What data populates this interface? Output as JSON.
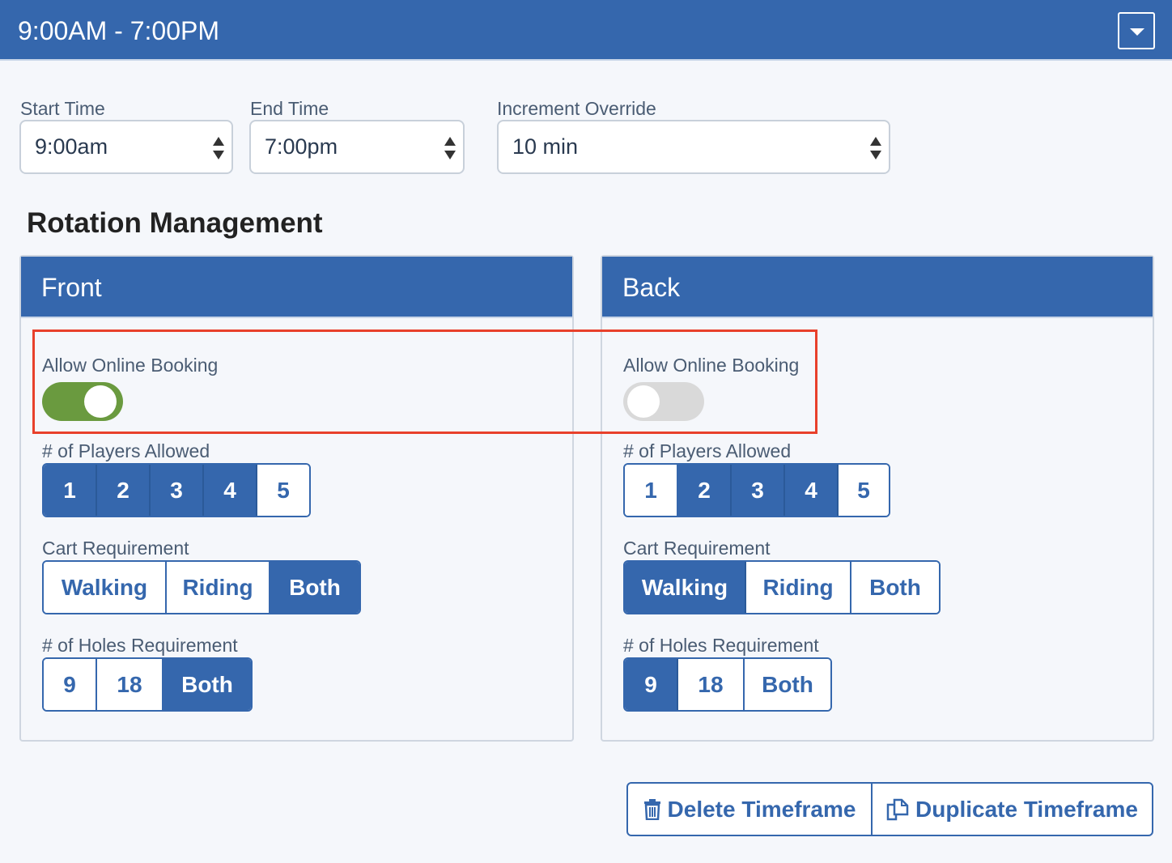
{
  "header": {
    "title": "9:00AM - 7:00PM",
    "menu_icon": "caret-down-icon"
  },
  "times": {
    "start_label": "Start Time",
    "start_value": "9:00am",
    "end_label": "End Time",
    "end_value": "7:00pm",
    "increment_label": "Increment Override",
    "increment_value": "10 min"
  },
  "rotation": {
    "title": "Rotation Management",
    "front": {
      "title": "Front",
      "online_label": "Allow Online Booking",
      "online_enabled": true,
      "players_label": "# of Players Allowed",
      "players": [
        "1",
        "2",
        "3",
        "4",
        "5"
      ],
      "players_selected": [
        "1",
        "2",
        "3",
        "4"
      ],
      "cart_label": "Cart Requirement",
      "cart": [
        "Walking",
        "Riding",
        "Both"
      ],
      "cart_selected": "Both",
      "holes_label": "# of Holes Requirement",
      "holes": [
        "9",
        "18",
        "Both"
      ],
      "holes_selected": "Both"
    },
    "back": {
      "title": "Back",
      "online_label": "Allow Online Booking",
      "online_enabled": false,
      "players_label": "# of Players Allowed",
      "players": [
        "1",
        "2",
        "3",
        "4",
        "5"
      ],
      "players_selected": [
        "2",
        "3",
        "4"
      ],
      "cart_label": "Cart Requirement",
      "cart": [
        "Walking",
        "Riding",
        "Both"
      ],
      "cart_selected": "Walking",
      "holes_label": "# of Holes Requirement",
      "holes": [
        "9",
        "18",
        "Both"
      ],
      "holes_selected": "9"
    }
  },
  "actions": {
    "delete_label": "Delete Timeframe",
    "delete_icon": "trash-icon",
    "duplicate_label": "Duplicate Timeframe",
    "duplicate_icon": "copy-icon"
  },
  "colors": {
    "brand": "#3567ad",
    "toggle_on": "#6a9a3f",
    "highlight": "#e8402b"
  }
}
